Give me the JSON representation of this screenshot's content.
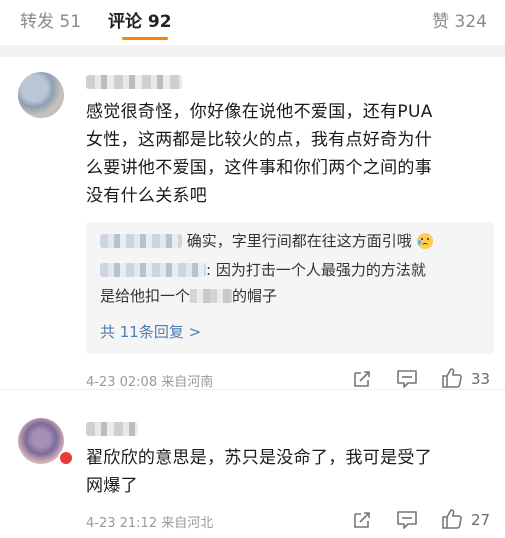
{
  "tabs": {
    "repost": "转发 51",
    "comment": "评论 92",
    "like": "赞 324"
  },
  "comments": [
    {
      "text_lines": [
        "感觉很奇怪，你好像在说他不爱国，还有PUA",
        "女性，这两都是比较火的点，我有点好奇为什",
        "么要讲他不爱国，这件事和你们两个之间的事",
        "没有什么关系吧"
      ],
      "replies": [
        {
          "text": "确实，字里行间都在往这方面引哦"
        },
        {
          "text_part1": ": 因为打击一个人最强力的方法就",
          "text_part2": "是给他扣一个",
          "text_part3": "的帽子"
        }
      ],
      "more_replies": "共 11条回复 >",
      "time": "4-23 02:08",
      "location": "来自河南",
      "likes": "33",
      "icons": [
        "share-icon",
        "comment-icon",
        "thumbs-up-icon"
      ]
    },
    {
      "text_lines": [
        "翟欣欣的意思是，苏只是没命了，我可是受了",
        "网爆了"
      ],
      "time": "4-23 21:12",
      "location": "来自河北",
      "likes": "27",
      "icons": [
        "share-icon",
        "comment-icon",
        "thumbs-up-icon"
      ]
    }
  ],
  "colors": {
    "accent": "#ff8200",
    "link": "#507daf",
    "muted": "#9a9a9a"
  }
}
